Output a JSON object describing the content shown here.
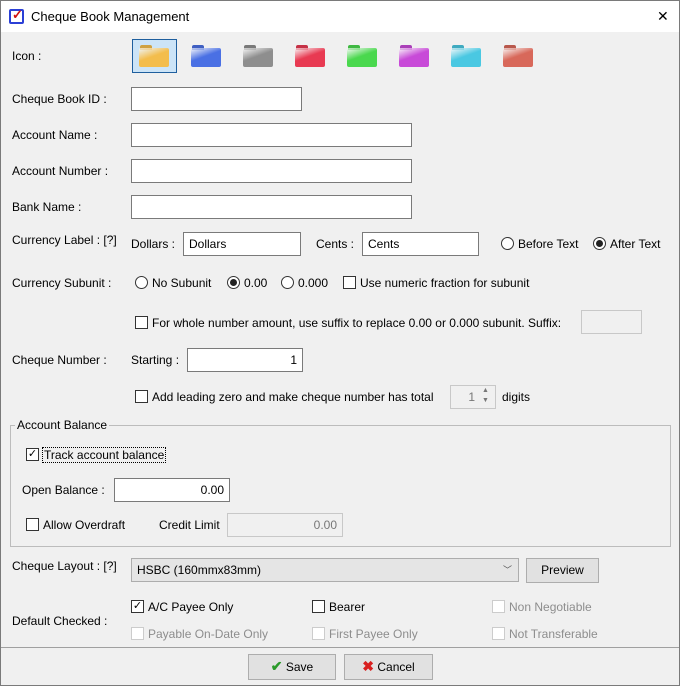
{
  "window": {
    "title": "Cheque Book Management",
    "close": "✕"
  },
  "icon": {
    "label": "Icon :",
    "colors": [
      "#f3bd4c",
      "#4a70e4",
      "#8e8e8e",
      "#e83a52",
      "#4ad84e",
      "#c84ad8",
      "#4ac8e2",
      "#d8685a"
    ],
    "selected": 0
  },
  "fields": {
    "cheque_book_id": {
      "label": "Cheque Book ID :",
      "value": ""
    },
    "account_name": {
      "label": "Account Name :",
      "value": ""
    },
    "account_number": {
      "label": "Account Number :",
      "value": ""
    },
    "bank_name": {
      "label": "Bank Name :",
      "value": ""
    }
  },
  "currency_label": {
    "label": "Currency Label : [?]",
    "dollars_label": "Dollars :",
    "dollars_value": "Dollars",
    "cents_label": "Cents :",
    "cents_value": "Cents",
    "before_text": "Before Text",
    "after_text": "After Text",
    "selected": "after"
  },
  "currency_subunit": {
    "label": "Currency Subunit :",
    "no_subunit": "No Subunit",
    "two": "0.00",
    "three": "0.000",
    "numeric_fraction": "Use numeric fraction for subunit",
    "suffix_option": "For whole number amount, use suffix to replace 0.00 or 0.000 subunit. Suffix:",
    "suffix_value": ""
  },
  "cheque_number": {
    "label": "Cheque Number :",
    "starting_label": "Starting :",
    "starting_value": "1",
    "leading_zero": "Add leading zero and make cheque number has total",
    "digits_value": "1",
    "digits_label": "digits"
  },
  "account_balance": {
    "legend": "Account Balance",
    "track": "Track account balance",
    "track_checked": true,
    "open_balance_label": "Open Balance :",
    "open_balance_value": "0.00",
    "allow_overdraft": "Allow Overdraft",
    "credit_limit_label": "Credit Limit",
    "credit_limit_value": "0.00"
  },
  "cheque_layout": {
    "label": "Cheque Layout : [?]",
    "selected": "HSBC (160mmx83mm)",
    "preview": "Preview"
  },
  "default_checked": {
    "label": "Default Checked :",
    "options": [
      {
        "label": "A/C Payee Only",
        "checked": true,
        "enabled": true
      },
      {
        "label": "Bearer",
        "checked": false,
        "enabled": true
      },
      {
        "label": "Non Negotiable",
        "checked": false,
        "enabled": false
      },
      {
        "label": "Payable On-Date Only",
        "checked": false,
        "enabled": false
      },
      {
        "label": "First Payee Only",
        "checked": false,
        "enabled": false
      },
      {
        "label": "Not Transferable",
        "checked": false,
        "enabled": false
      }
    ]
  },
  "footer": {
    "save": "Save",
    "cancel": "Cancel"
  }
}
